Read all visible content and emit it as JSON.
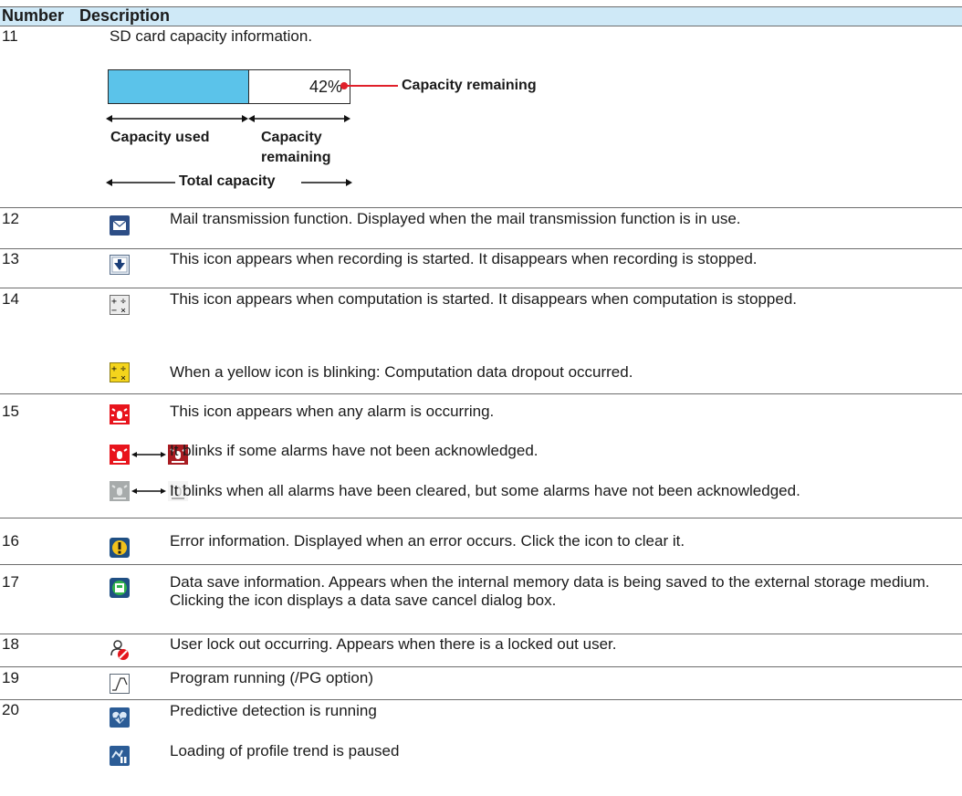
{
  "header": {
    "number": "Number",
    "description": "Description"
  },
  "capacity": {
    "num": "11",
    "title": "SD card capacity information.",
    "percent": 42,
    "percent_label": "42%",
    "callout": "Capacity remaining",
    "used_label": "Capacity used",
    "remaining_label_1": "Capacity",
    "remaining_label_2": "remaining",
    "total_label": "Total capacity",
    "bar_fill_color": "#5bc3ea"
  },
  "rows": [
    {
      "num": "12",
      "icon": "mail-icon",
      "text": "Mail transmission function. Displayed when the mail transmission function is in use."
    },
    {
      "num": "13",
      "icon": "recording-icon",
      "text": "This icon appears when recording is started. It disappears when recording is stopped."
    },
    {
      "num": "14",
      "icon": "computation-icon",
      "text": "This icon appears when computation is started. It disappears when computation is stopped."
    },
    {
      "num": "",
      "icon": "computation-dropout-icon",
      "text": "When a yellow icon is blinking: Computation data dropout occurred."
    },
    {
      "num": "15",
      "icon": "alarm-icon",
      "text": "This icon appears when any alarm is occurring."
    },
    {
      "num": "",
      "icon": "alarm-blink-red-icon",
      "text": "It blinks if some alarms have not been acknowledged."
    },
    {
      "num": "",
      "icon": "alarm-blink-gray-icon",
      "text": "It blinks when all alarms have been cleared, but some alarms have not been acknowledged."
    },
    {
      "num": "16",
      "icon": "error-icon",
      "text": "Error information. Displayed when an error occurs. Click the icon to clear it."
    },
    {
      "num": "17",
      "icon": "data-save-icon",
      "text": "Data save information. Appears when the internal memory data is being saved to the external storage medium. Clicking the icon displays a data save cancel dialog box."
    },
    {
      "num": "18",
      "icon": "user-lockout-icon",
      "text": "User lock out occurring. Appears when there is a locked out user."
    },
    {
      "num": "19",
      "icon": "program-running-icon",
      "text": " Program running (/PG option)"
    },
    {
      "num": "20",
      "icon": "predictive-detection-icon",
      "text": "Predictive detection is running"
    },
    {
      "num": "",
      "icon": "profile-trend-paused-icon",
      "text": "Loading of profile trend is paused"
    }
  ]
}
